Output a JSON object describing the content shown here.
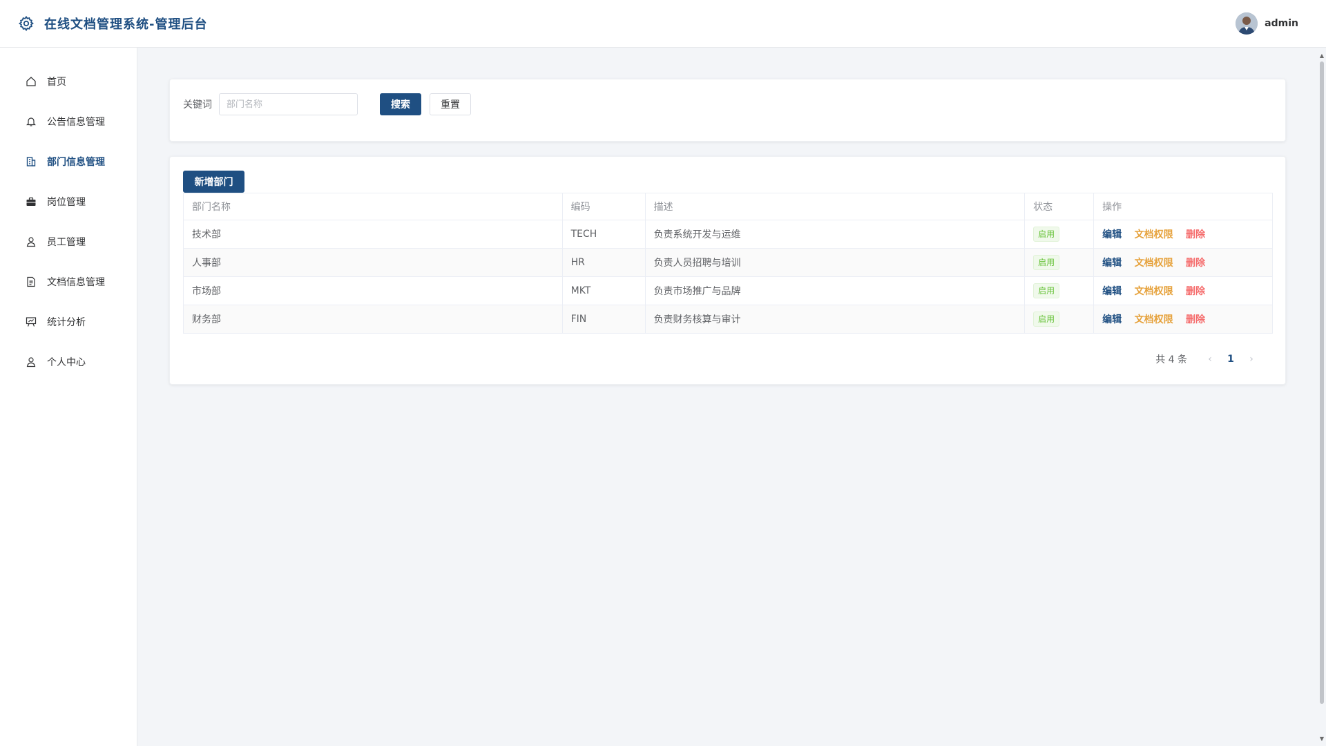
{
  "header": {
    "title": "在线文档管理系统-管理后台",
    "logo_icon": "gear-icon",
    "username": "admin"
  },
  "sidebar": {
    "items": [
      {
        "label": "首页",
        "icon": "home-icon"
      },
      {
        "label": "公告信息管理",
        "icon": "bell-icon"
      },
      {
        "label": "部门信息管理",
        "icon": "building-icon",
        "active": true
      },
      {
        "label": "岗位管理",
        "icon": "briefcase-icon"
      },
      {
        "label": "员工管理",
        "icon": "user-icon"
      },
      {
        "label": "文档信息管理",
        "icon": "document-icon"
      },
      {
        "label": "统计分析",
        "icon": "chart-board-icon"
      },
      {
        "label": "个人中心",
        "icon": "user-icon"
      }
    ]
  },
  "search": {
    "keyword_label": "关键词",
    "placeholder": "部门名称",
    "value": "",
    "search_label": "搜索",
    "reset_label": "重置"
  },
  "table": {
    "add_label": "新增部门",
    "columns": [
      "部门名称",
      "编码",
      "描述",
      "状态",
      "操作"
    ],
    "rows": [
      {
        "name": "技术部",
        "code": "TECH",
        "desc": "负责系统开发与运维",
        "status": "启用"
      },
      {
        "name": "人事部",
        "code": "HR",
        "desc": "负责人员招聘与培训",
        "status": "启用"
      },
      {
        "name": "市场部",
        "code": "MKT",
        "desc": "负责市场推广与品牌",
        "status": "启用"
      },
      {
        "name": "财务部",
        "code": "FIN",
        "desc": "负责财务核算与审计",
        "status": "启用"
      }
    ],
    "actions": {
      "edit": "编辑",
      "perm": "文档权限",
      "delete": "删除"
    }
  },
  "pagination": {
    "total_text": "共 4 条",
    "current_page": "1",
    "prev": "‹",
    "next": "›"
  },
  "colors": {
    "primary": "#1f4f82",
    "warning": "#e6a23c",
    "danger": "#f56c6c",
    "success": "#67c23a"
  }
}
